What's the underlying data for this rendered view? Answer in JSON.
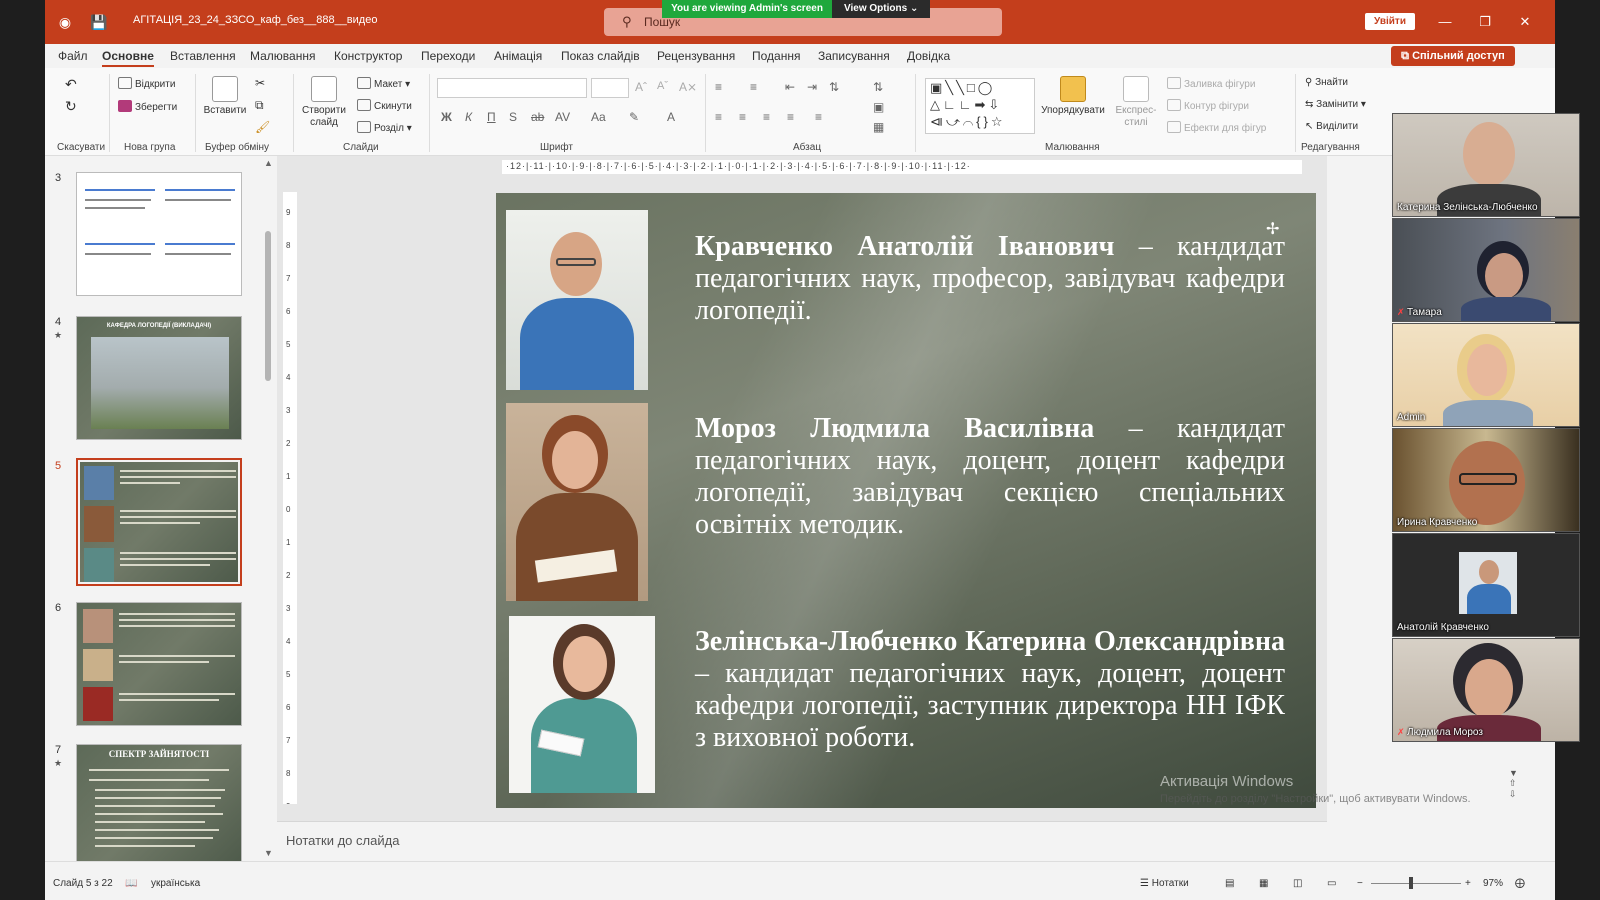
{
  "window": {
    "doc_title": "АГІТАЦІЯ_23_24_ЗЗСО_каф_без__888__видео",
    "search_placeholder": "Пошук",
    "banner_text": "You are viewing Admin's screen",
    "view_options": "View Options",
    "sign_in": "Увійти"
  },
  "menu": {
    "tabs": [
      "Файл",
      "Основне",
      "Вставлення",
      "Малювання",
      "Конструктор",
      "Переходи",
      "Анімація",
      "Показ слайдів",
      "Рецензування",
      "Подання",
      "Записування",
      "Довідка"
    ],
    "active": "Основне",
    "share": "Спільний доступ"
  },
  "ribbon": {
    "open": "Відкрити",
    "save": "Зберегти",
    "paste": "Вставити",
    "new_slide": "Створити слайд",
    "layout": "Макет",
    "reset": "Скинути",
    "section": "Розділ",
    "arrange": "Упорядкувати",
    "quick_styles": "Експрес-стилі",
    "shape_fill": "Заливка фігури",
    "shape_outline": "Контур фігури",
    "shape_effects": "Ефекти для фігур",
    "find": "Знайти",
    "replace": "Замінити",
    "select": "Виділити",
    "bold": "Ж",
    "italic": "К",
    "underline": "П",
    "strike": "S",
    "groups": {
      "undo": "Скасувати",
      "new_group": "Нова група",
      "clipboard": "Буфер обміну",
      "slides": "Слайди",
      "font": "Шрифт",
      "paragraph": "Абзац",
      "drawing": "Малювання",
      "editing": "Редагування"
    }
  },
  "thumbnails": [
    {
      "num": "3",
      "star": false,
      "title": ""
    },
    {
      "num": "4",
      "star": true,
      "title": "КАФЕДРА ЛОГОПЕДІЇ (ВИКЛАДАЧІ)"
    },
    {
      "num": "5",
      "star": false,
      "title": ""
    },
    {
      "num": "6",
      "star": false,
      "title": ""
    },
    {
      "num": "7",
      "star": true,
      "title": "СПЕКТР ЗАЙНЯТОСТІ"
    }
  ],
  "slide": {
    "p1_name": "Кравченко Анатолій Іванович",
    "p1_desc": " – кандидат педагогічних наук, професор, завідувач кафедри логопедії.",
    "p2_name": "Мороз Людмила Василівна",
    "p2_desc": " – кандидат педагогічних наук, доцент, доцент кафедри логопедії, завідувач секцією спеціальних освітніх методик.",
    "p3_name": "Зелінська-Любченко Катерина Олександрівна",
    "p3_desc": " – кандидат педагогічних наук, доцент, доцент кафедри логопедії, заступник директора НН ІФК з виховної роботи.",
    "activation_title": "Активація Windows",
    "activation_sub": "Перейдіть до розділу \"Настройки\", щоб активувати Windows."
  },
  "notes_placeholder": "Нотатки до слайда",
  "status": {
    "slide_of": "Слайд 5 з 22",
    "language": "українська",
    "notes": "Нотатки",
    "zoom": "97%"
  },
  "participants": [
    {
      "name": "Катерина Зелінська-Любченко",
      "muted": false
    },
    {
      "name": "Тамара",
      "muted": true
    },
    {
      "name": "Admin",
      "muted": false
    },
    {
      "name": "Ирина Кравченко",
      "muted": false
    },
    {
      "name": "Анатолій Кравченко",
      "muted": false
    },
    {
      "name": "Людмила Мороз",
      "muted": true
    }
  ],
  "colors": {
    "accent": "#c43e1c",
    "banner_green": "#1fa83c"
  }
}
